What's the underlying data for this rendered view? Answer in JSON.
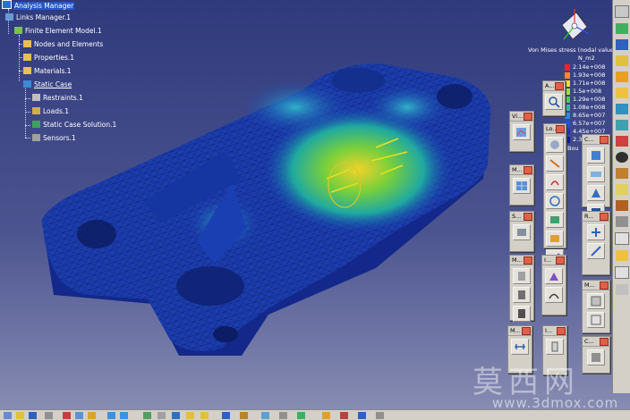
{
  "tree": {
    "items": [
      {
        "label": "Analysis Manager",
        "icon": "analysis-manager-icon"
      },
      {
        "label": "Links Manager.1",
        "icon": "links-icon"
      },
      {
        "label": "Finite Element Model.1",
        "icon": "fem-model-icon"
      },
      {
        "label": "Nodes and Elements",
        "icon": "folder-icon"
      },
      {
        "label": "Properties.1",
        "icon": "folder-icon"
      },
      {
        "label": "Materials.1",
        "icon": "folder-icon"
      },
      {
        "label": "Static Case",
        "icon": "static-case-icon"
      },
      {
        "label": "Restraints.1",
        "icon": "restraint-icon"
      },
      {
        "label": "Loads.1",
        "icon": "load-icon"
      },
      {
        "label": "Static Case Solution.1",
        "icon": "solution-icon"
      },
      {
        "label": "Sensors.1",
        "icon": "sensor-icon"
      }
    ]
  },
  "legend": {
    "title": "Von Mises stress (nodal values)",
    "unit": "N_m2",
    "values": [
      "2.14e+008",
      "1.93e+008",
      "1.71e+008",
      "1.5e+008",
      "1.29e+008",
      "1.08e+008",
      "8.65e+007",
      "6.57e+007",
      "4.45e+007",
      "2.36e+007"
    ],
    "footer": "Bou"
  },
  "toolbars": [
    {
      "title": "A...",
      "buttons": [
        "zoom-analysis-icon"
      ]
    },
    {
      "title": "Vi...",
      "buttons": [
        "view-results-icon"
      ]
    },
    {
      "title": "Lo...",
      "buttons": [
        "pressure-icon",
        "distributed-force-icon",
        "moment-icon",
        "bearing-load-icon",
        "importance-force-icon",
        "body-force-icon",
        "line-force-icon"
      ]
    },
    {
      "title": "C...",
      "buttons": [
        "clamp-icon",
        "surface-slider-icon",
        "advanced-restraint-icon",
        "isostatic-icon"
      ]
    },
    {
      "title": "M...",
      "buttons": [
        "mesh-icon"
      ]
    },
    {
      "title": "S...",
      "buttons": [
        "sensor-icon"
      ]
    },
    {
      "title": "R...",
      "buttons": [
        "rigid-connection-icon",
        "smooth-connection-icon"
      ]
    },
    {
      "title": "M...",
      "buttons": [
        "mesh-part-icon",
        "local-size-icon",
        "local-sag-icon"
      ]
    },
    {
      "title": "I...",
      "buttons": [
        "image-icon",
        "deformation-icon"
      ]
    },
    {
      "title": "M...",
      "buttons": [
        "mesh-visual-icon",
        "octree-icon"
      ]
    },
    {
      "title": "M...",
      "buttons": [
        "measure-icon"
      ]
    },
    {
      "title": "I...",
      "buttons": [
        "info-icon"
      ]
    },
    {
      "title": "C...",
      "buttons": [
        "compute-icon"
      ]
    }
  ],
  "watermark": {
    "chinese": "莫西网",
    "url": "www.3dmox.com"
  },
  "colors": {
    "background_top": "#2f3a7c",
    "background_bottom": "#8a8fb4",
    "tree_selection": "#2457c8",
    "toolbar_face": "#d4d0c8"
  }
}
